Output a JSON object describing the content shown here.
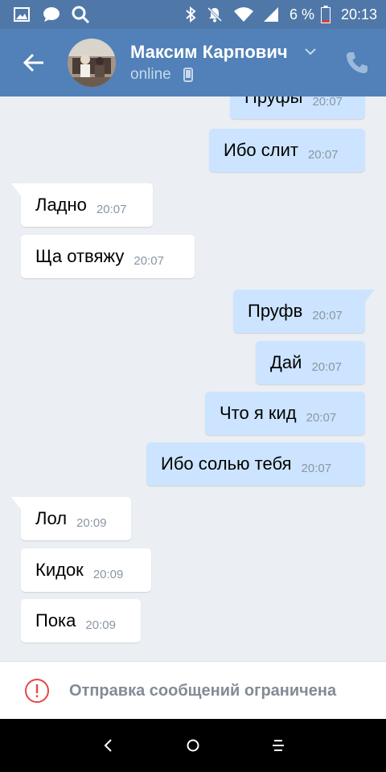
{
  "status_bar": {
    "icons_left": [
      "image-icon",
      "chat-bubble-icon",
      "search-icon"
    ],
    "icons_right": [
      "bluetooth-icon",
      "mute-icon",
      "wifi-icon",
      "signal-icon"
    ],
    "battery": "6 %",
    "time": "20:13"
  },
  "header": {
    "contact_name": "Максим Карпович",
    "status": "online",
    "accent": "#5181b8"
  },
  "messages": [
    {
      "dir": "out",
      "text": "Пруфы",
      "time": "20:07"
    },
    {
      "dir": "out",
      "text": "Ибо слит",
      "time": "20:07"
    },
    {
      "dir": "in",
      "text": "Ладно",
      "time": "20:07"
    },
    {
      "dir": "in",
      "text": "Ща отвяжу",
      "time": "20:07"
    },
    {
      "dir": "out",
      "text": "Пруфв",
      "time": "20:07"
    },
    {
      "dir": "out",
      "text": "Дай",
      "time": "20:07"
    },
    {
      "dir": "out",
      "text": "Что я кид",
      "time": "20:07"
    },
    {
      "dir": "out",
      "text": "Ибо солью тебя",
      "time": "20:07"
    },
    {
      "dir": "in",
      "text": "Лол",
      "time": "20:09"
    },
    {
      "dir": "in",
      "text": "Кидок",
      "time": "20:09"
    },
    {
      "dir": "in",
      "text": "Пока",
      "time": "20:09"
    }
  ],
  "footer": {
    "notice": "Отправка сообщений ограничена"
  },
  "nav": {
    "buttons": [
      "back-nav-icon",
      "home-nav-icon",
      "menu-nav-icon"
    ]
  }
}
